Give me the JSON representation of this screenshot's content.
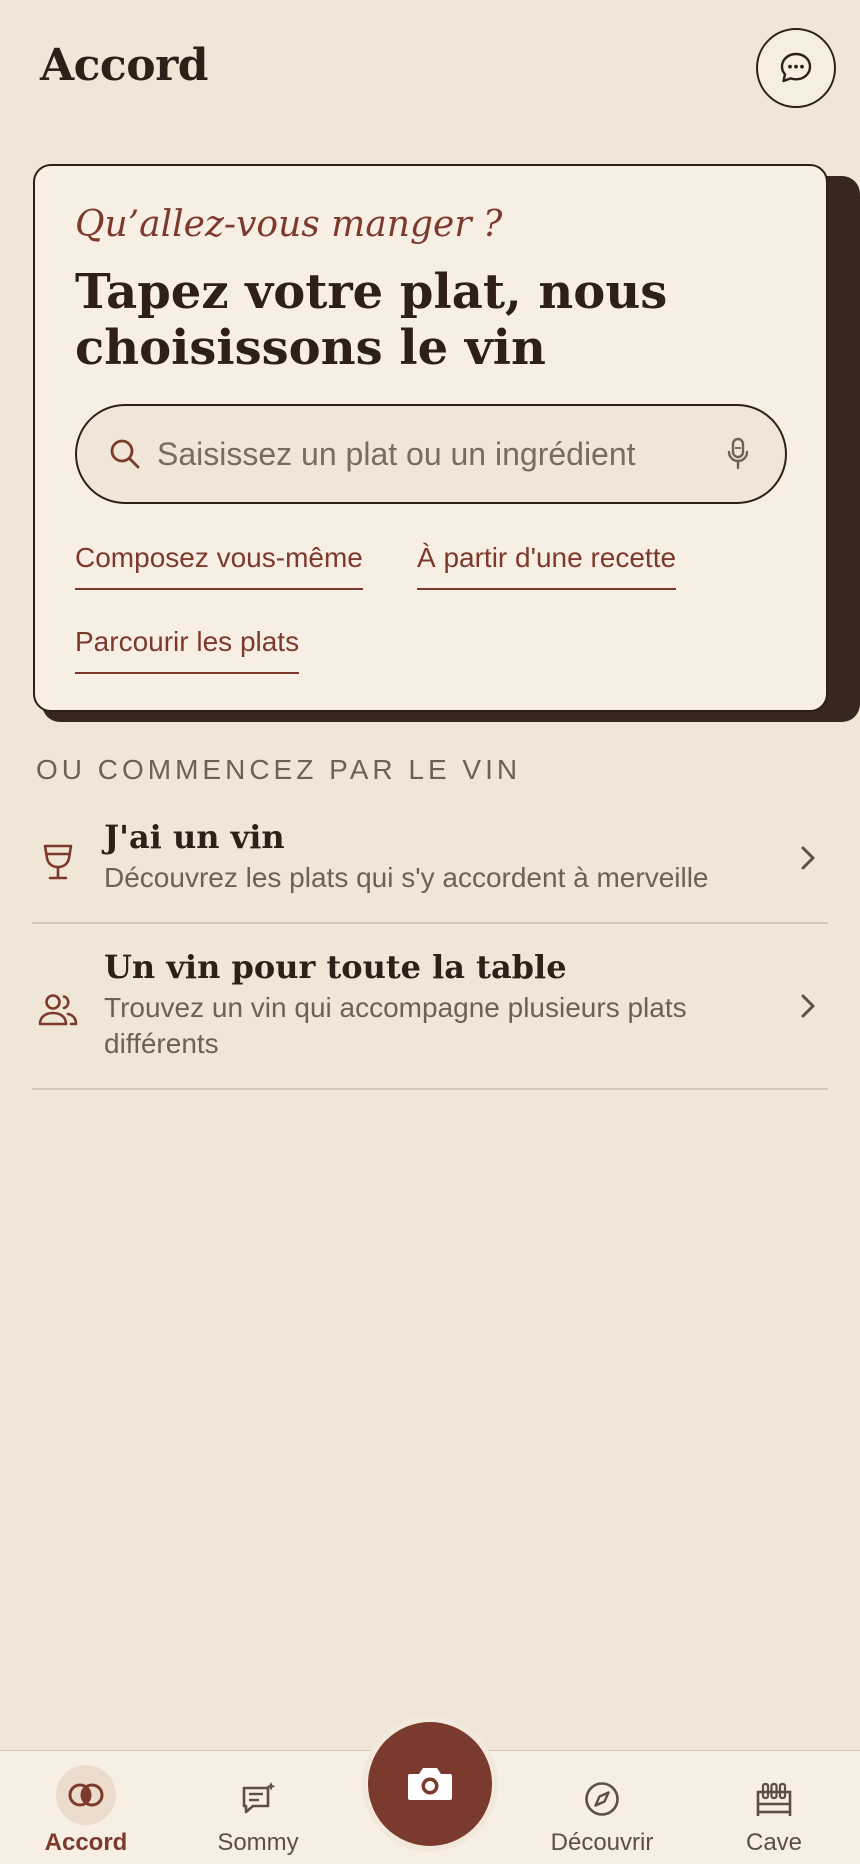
{
  "header": {
    "title": "Accord",
    "chat_icon": "chat-bubble-icon"
  },
  "hero_card": {
    "kicker": "Qu’allez-vous manger ?",
    "heading": "Tapez votre plat, nous choisissons le vin",
    "search": {
      "placeholder": "Saisissez un plat ou un ingrédient"
    },
    "links": {
      "compose": "Composez vous-même",
      "recipe": "À partir d'une recette",
      "browse": "Parcourir les plats"
    }
  },
  "wine_section": {
    "label": "OU COMMENCEZ PAR LE VIN",
    "items": [
      {
        "title": "J'ai un vin",
        "subtitle": "Découvrez les plats qui s'y accordent à merveille",
        "icon": "wine-glass-icon"
      },
      {
        "title": "Un vin pour toute la table",
        "subtitle": "Trouvez un vin qui accompagne plusieurs plats différents",
        "icon": "people-icon"
      }
    ]
  },
  "tabbar": {
    "tabs": [
      {
        "label": "Accord",
        "icon": "rings-icon",
        "active": true
      },
      {
        "label": "Sommy",
        "icon": "message-sparkle-icon"
      },
      {
        "label": "Découvrir",
        "icon": "compass-icon"
      },
      {
        "label": "Cave",
        "icon": "wine-rack-icon"
      }
    ],
    "center_action_icon": "camera-icon"
  },
  "colors": {
    "background": "#efe6d8",
    "accent": "#7d3a2c",
    "ink": "#2e2018",
    "card": "#f7efe4"
  }
}
